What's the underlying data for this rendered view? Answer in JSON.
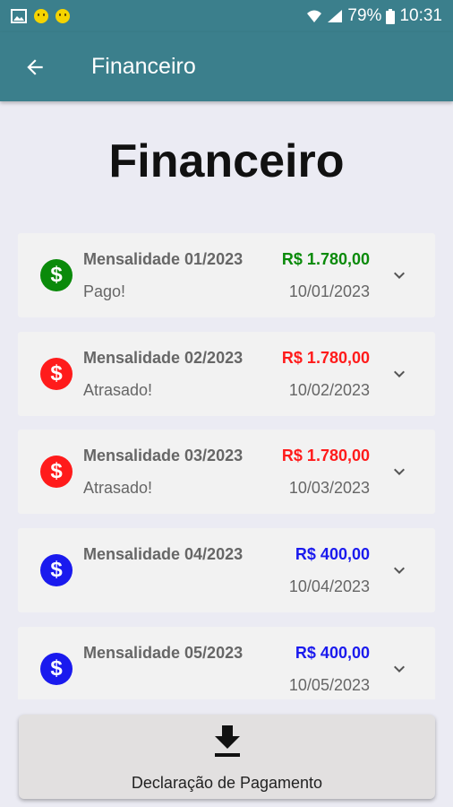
{
  "status_bar": {
    "battery": "79%",
    "time": "10:31"
  },
  "app_bar": {
    "title": "Financeiro"
  },
  "page": {
    "heading": "Financeiro"
  },
  "colors": {
    "paid": "#0a8a0a",
    "overdue": "#ff1b1b",
    "pending": "#1a1aee",
    "app_bar": "#3b7f8c"
  },
  "payments": [
    {
      "title": "Mensalidade 01/2023",
      "status": "Pago!",
      "amount": "R$ 1.780,00",
      "date": "10/01/2023",
      "state": "paid"
    },
    {
      "title": "Mensalidade 02/2023",
      "status": "Atrasado!",
      "amount": "R$ 1.780,00",
      "date": "10/02/2023",
      "state": "overdue"
    },
    {
      "title": "Mensalidade 03/2023",
      "status": "Atrasado!",
      "amount": "R$ 1.780,00",
      "date": "10/03/2023",
      "state": "overdue"
    },
    {
      "title": "Mensalidade 04/2023",
      "status": "",
      "amount": "R$ 400,00",
      "date": "10/04/2023",
      "state": "pending"
    },
    {
      "title": "Mensalidade 05/2023",
      "status": "",
      "amount": "R$ 400,00",
      "date": "10/05/2023",
      "state": "pending"
    }
  ],
  "declaration": {
    "label": "Declaração de Pagamento",
    "icon": "download-icon"
  }
}
